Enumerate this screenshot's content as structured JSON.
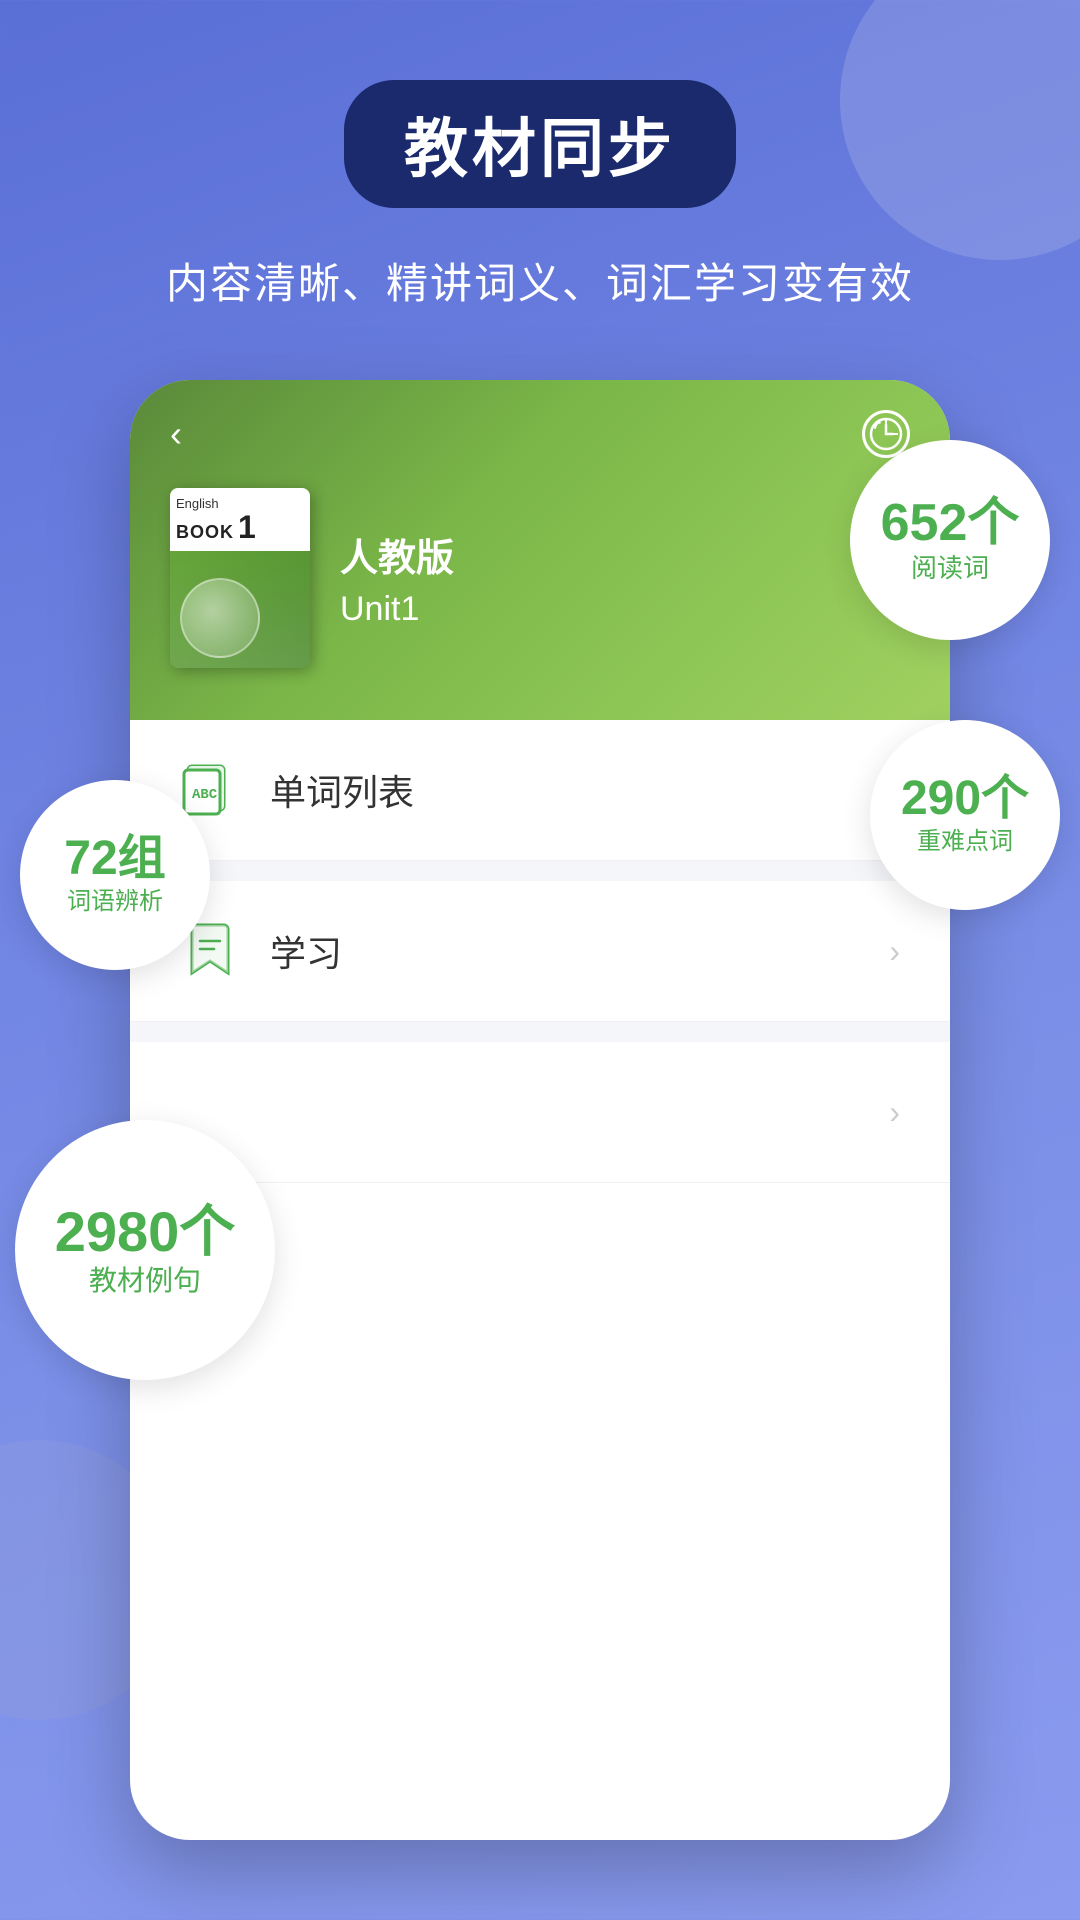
{
  "page": {
    "title": "教材同步",
    "subtitle": "内容清晰、精讲词义、词汇学习变有效"
  },
  "phone": {
    "back_button": "‹",
    "book": {
      "english_label": "English",
      "book_label": "BOOK",
      "book_number": "1",
      "publisher": "人教版",
      "unit": "Unit1"
    },
    "menu_items": [
      {
        "id": "word-list",
        "icon": "abc-icon",
        "label": "单词列表",
        "has_arrow": true
      },
      {
        "id": "study",
        "icon": "bookmark-icon",
        "label": "学习",
        "has_arrow": true
      },
      {
        "id": "third",
        "icon": "",
        "label": "",
        "has_arrow": true
      }
    ]
  },
  "stats": [
    {
      "id": "reading-words",
      "number": "652个",
      "label": "阅读词"
    },
    {
      "id": "key-words",
      "number": "290个",
      "label": "重难点词"
    },
    {
      "id": "word-groups",
      "number": "72组",
      "label": "词语辨析"
    },
    {
      "id": "example-sentences",
      "number": "2980个",
      "label": "教材例句"
    }
  ]
}
